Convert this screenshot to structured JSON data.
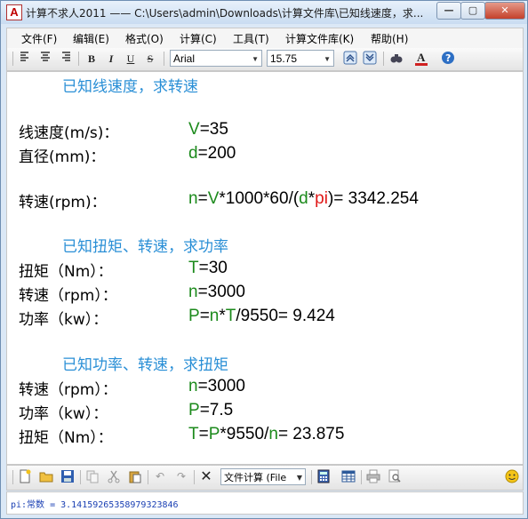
{
  "window": {
    "title": "计算不求人2011 —— C:\\Users\\admin\\Downloads\\计算文件库\\已知线速度，求...",
    "minimize_label": "—",
    "maximize_label": "▢",
    "close_label": "✕"
  },
  "menu": [
    "文件(F)",
    "编辑(E)",
    "格式(O)",
    "计算(C)",
    "工具(T)",
    "计算文件库(K)",
    "帮助(H)"
  ],
  "toolbar": {
    "bold": "B",
    "italic": "I",
    "underline": "U",
    "strike": "S",
    "font_name": "Arial",
    "font_size": "15.75"
  },
  "document": {
    "section1_header": "已知线速度，求转速",
    "s1_l1_label": "线速度(m/s)：",
    "s1_l1_var": "V",
    "s1_l1_val": "=35",
    "s1_l2_label": "直径(mm)：",
    "s1_l2_var": "d",
    "s1_l2_val": "=200",
    "s1_l3_label": "转速(rpm)：",
    "s1_l3_p1": "n",
    "s1_l3_p2": "=",
    "s1_l3_p3": "V",
    "s1_l3_p4": "*1000*60/(",
    "s1_l3_p5": "d",
    "s1_l3_p6": "*",
    "s1_l3_p7": "pi",
    "s1_l3_p8": ")= 3342.254",
    "section2_header": "已知扭矩、转速，求功率",
    "s2_l1_label": "扭矩（Nm）：",
    "s2_l1_var": "T",
    "s2_l1_val": "=30",
    "s2_l2_label": "转速（rpm）：",
    "s2_l2_var": "n",
    "s2_l2_val": "=3000",
    "s2_l3_label": "功率（kw）：",
    "s2_l3_p1": "P",
    "s2_l3_p2": "=",
    "s2_l3_p3": "n",
    "s2_l3_p4": "*",
    "s2_l3_p5": "T",
    "s2_l3_p6": "/9550= 9.424",
    "section3_header": "已知功率、转速，求扭矩",
    "s3_l1_label": "转速（rpm）：",
    "s3_l1_var": "n",
    "s3_l1_val": "=3000",
    "s3_l2_label": "功率（kw）：",
    "s3_l2_var": "P",
    "s3_l2_val": "=7.5",
    "s3_l3_label": "扭矩（Nm）：",
    "s3_l3_p1": "T",
    "s3_l3_p2": "=",
    "s3_l3_p3": "P",
    "s3_l3_p4": "*9550/",
    "s3_l3_p5": "n",
    "s3_l3_p6": "= 23.875"
  },
  "bottom_toolbar": {
    "calc_mode": "文件计算 (File"
  },
  "status": {
    "text": "pi:常数 = 3.14159265358979323846"
  }
}
